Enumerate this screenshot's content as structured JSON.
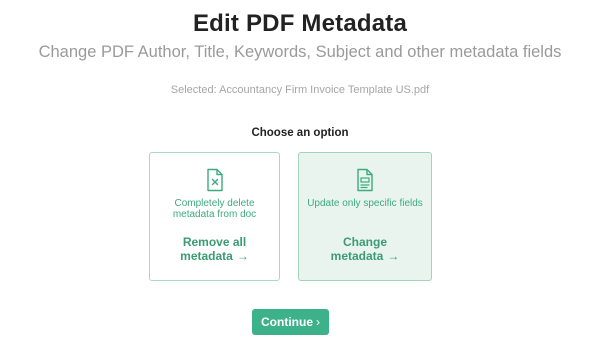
{
  "header": {
    "title": "Edit PDF Metadata",
    "subtitle": "Change PDF Author, Title, Keywords, Subject and other metadata fields"
  },
  "file": {
    "selected_text": "Selected: Accountancy Firm Invoice Template US.pdf"
  },
  "options": {
    "prompt": "Choose an option",
    "remove": {
      "description": "Completely delete metadata from doc",
      "action_line1": "Remove all",
      "action_line2": "metadata",
      "icon": "file-x-icon"
    },
    "change": {
      "description": "Update only specific fields",
      "action_line1": "Change",
      "action_line2": "metadata",
      "icon": "file-list-icon"
    }
  },
  "footer": {
    "continue_label": "Continue",
    "continue_chevron": "›"
  },
  "colors": {
    "accent": "#3db28a",
    "card_border": "#a9d9c3",
    "selected_card_bg": "#eaf4ef"
  }
}
